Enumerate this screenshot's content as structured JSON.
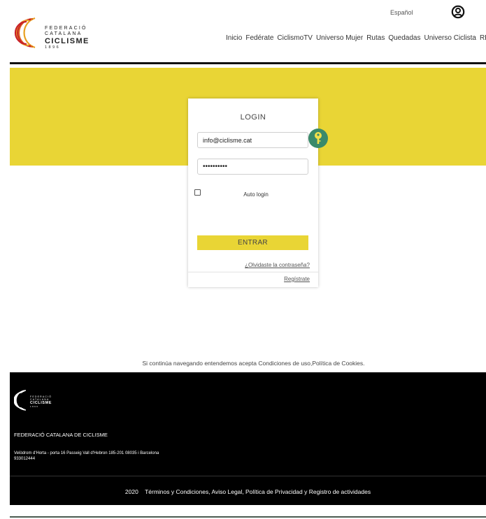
{
  "header": {
    "logo": {
      "line1": "FEDERACIÓ",
      "line2": "CATALANA",
      "line3": "CICLISME",
      "line4": "1896"
    },
    "language": "Español",
    "nav": [
      "Inicio",
      "Fedérate",
      "CiclismoTV",
      "Universo Mujer",
      "Rutas",
      "Quedadas",
      "Universo Ciclista",
      "RE"
    ]
  },
  "login": {
    "title": "LOGIN",
    "email_value": "info@ciclisme.cat",
    "password_value": "••••••••••",
    "auto_login_label": "Auto login",
    "auto_login_checked": false,
    "enter_label": "ENTRAR",
    "forgot_label": "¿Olvidaste la contraseña?",
    "register_label": "Regístrate"
  },
  "cookies": {
    "text": "Si continúa navegando entendemos acepta Condiciones de uso,Política de Cookies."
  },
  "footer": {
    "logo": {
      "line1": "FEDERACIÓ",
      "line2": "CATALANA",
      "line3": "CICLISME",
      "line4": "1896"
    },
    "org_name": "FEDERACIÓ CATALANA DE CICLISME",
    "address": "Velòdrom d'Horta - porta 16 Passeig Vall d'Hebron 185-201 08035 i Barcelona",
    "phone": "933012444",
    "year": "2020",
    "legal": "Términos y Condiciones, Aviso Legal, Política de Privacidad y Registro de actividades"
  },
  "colors": {
    "brand_yellow": "#e9d535",
    "key_badge": "#3a8a6a",
    "footer_bg": "#000000",
    "logo_red": "#c8202a",
    "logo_orange": "#e8a020"
  },
  "icons": [
    "user-icon",
    "key-icon",
    "logo-arcs-icon"
  ]
}
